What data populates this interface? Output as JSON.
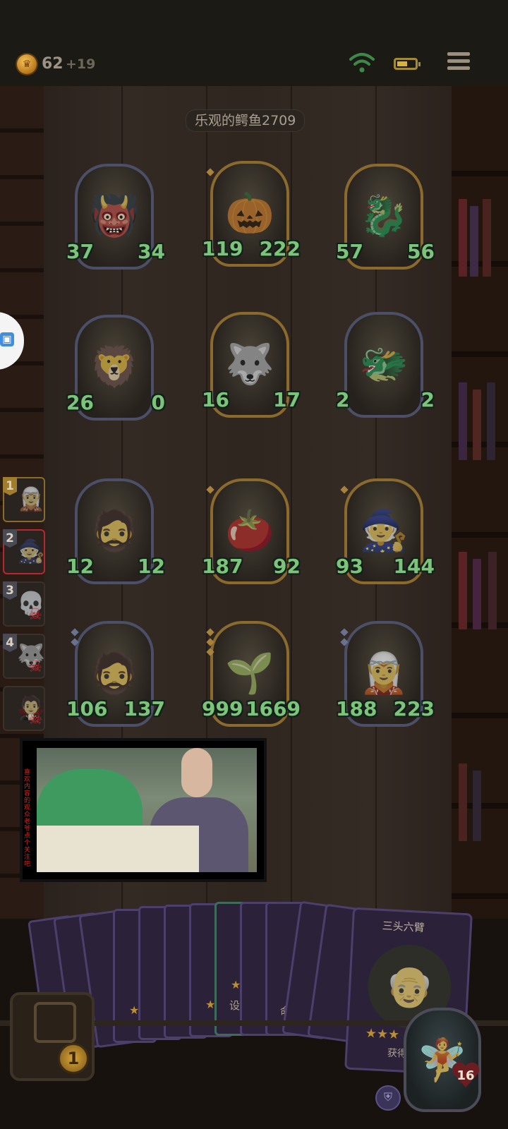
{
  "header": {
    "gold": "62",
    "gold_income": "+19",
    "icons": [
      "coin-icon",
      "wifi-icon",
      "battery-icon",
      "menu-icon"
    ]
  },
  "board": {
    "owner_name": "乐观的鳄鱼2709",
    "rows": [
      [
        {
          "name": "horned-elf",
          "attack": "37",
          "health": "34",
          "tier": "blue",
          "portrait": "👹"
        },
        {
          "name": "pumpkin-ghost",
          "attack": "119",
          "health": "222",
          "tier": "gold",
          "portrait": "🎃"
        },
        {
          "name": "golden-dragon",
          "attack": "57",
          "health": "56",
          "tier": "gold",
          "portrait": "🐉"
        }
      ],
      [
        {
          "name": "flame-chieftain",
          "attack": "26",
          "health": "0",
          "tier": "blue",
          "portrait": "🦁"
        },
        {
          "name": "beast-demon",
          "attack": "16",
          "health": "17",
          "tier": "gold",
          "portrait": "🐺"
        },
        {
          "name": "blue-dragonkin",
          "attack": "2",
          "health": "2",
          "tier": "blue",
          "portrait": "🐲"
        }
      ],
      [
        {
          "name": "bearded-warrior",
          "attack": "12",
          "health": "12",
          "tier": "blue",
          "portrait": "🧔"
        },
        {
          "name": "tomato-imp",
          "attack": "187",
          "health": "92",
          "tier": "gold",
          "portrait": "🍅"
        },
        {
          "name": "hat-witch",
          "attack": "93",
          "health": "144",
          "tier": "gold",
          "portrait": "🧙"
        }
      ],
      [
        {
          "name": "bearded-warrior-golden",
          "attack": "106",
          "health": "137",
          "tier": "blue",
          "portrait": "🧔"
        },
        {
          "name": "sprout-kid",
          "attack": "999",
          "health": "1669",
          "tier": "gold",
          "portrait": "🌱"
        },
        {
          "name": "elf-sorceress",
          "attack": "188",
          "health": "223",
          "tier": "blue",
          "portrait": "🧝"
        }
      ]
    ]
  },
  "leaderboard": [
    {
      "rank": "1",
      "portrait": "🧝",
      "status": "alive"
    },
    {
      "rank": "2",
      "portrait": "🧙",
      "status": "current"
    },
    {
      "rank": "3",
      "portrait": "💀",
      "status": "dead"
    },
    {
      "rank": "4",
      "portrait": "🐺",
      "status": "dead"
    },
    {
      "rank": "",
      "portrait": "🧛",
      "status": "dead"
    }
  ],
  "video": {
    "caption": "喜欢内容的观众老爷点个关注吧"
  },
  "hand": {
    "featured_card_title": "三头六臂",
    "featured_card_desc": "获得1张",
    "featured_card_portrait": "👴",
    "card_fragments": [
      "设",
      "命"
    ]
  },
  "player": {
    "health": "16",
    "hero_portrait": "🧚",
    "chest_count": "1"
  }
}
